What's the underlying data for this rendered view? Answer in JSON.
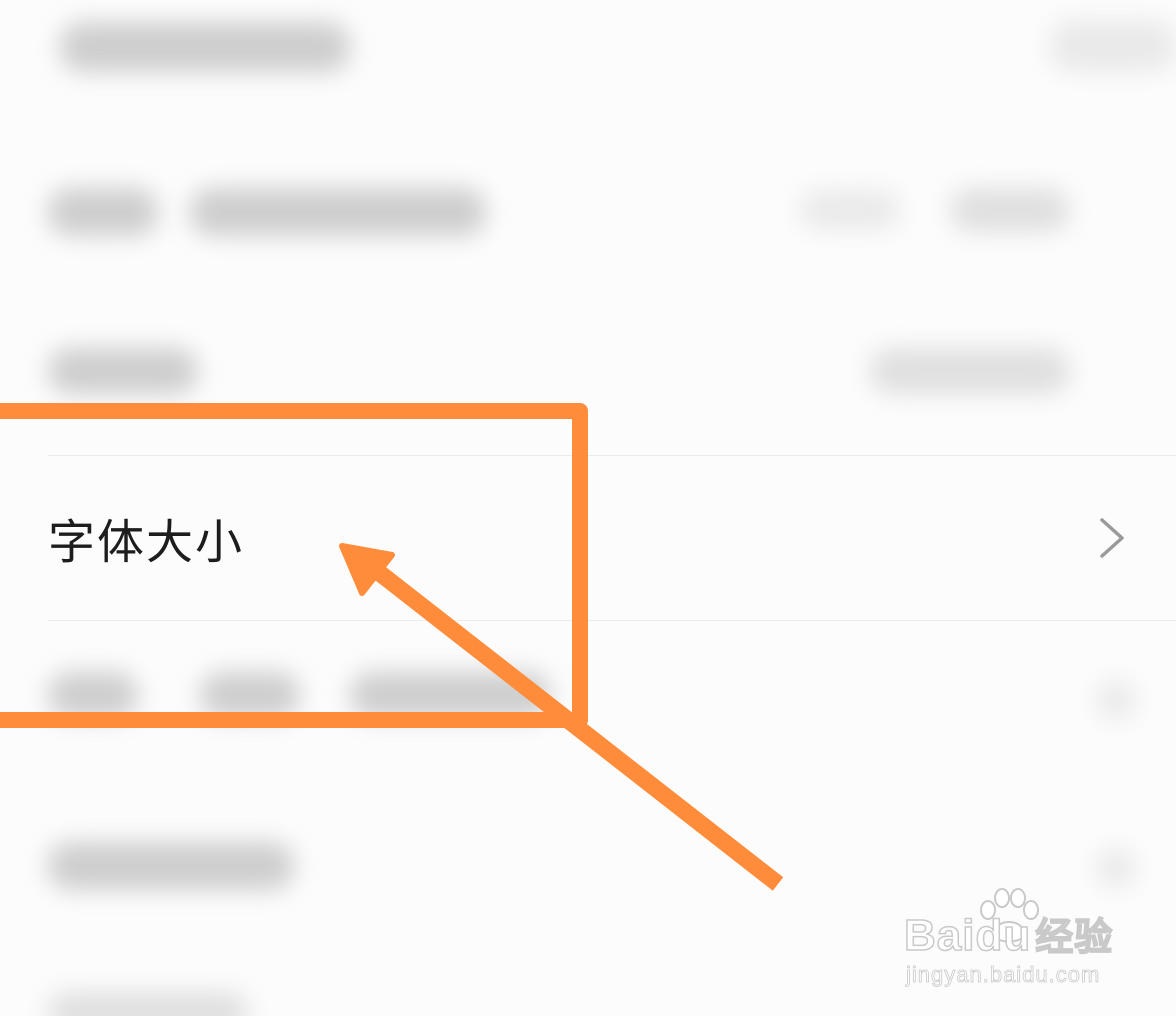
{
  "settings": {
    "font_size_row": {
      "label": "字体大小",
      "chevron_icon": "chevron-right-icon"
    }
  },
  "annotation": {
    "color": "#ff8c3a",
    "highlight": "rectangle",
    "pointer": "arrow-icon"
  },
  "watermark": {
    "brand_latin": "Bai",
    "brand_latin2": "du",
    "brand_cn": "经验",
    "url": "jingyan.baidu.com",
    "paw_icon": "paw-icon"
  }
}
